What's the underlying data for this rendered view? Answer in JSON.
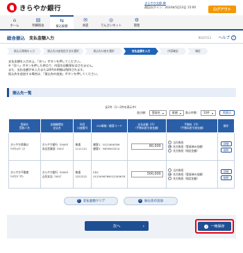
{
  "header": {
    "bank_name": "きらやか銀行",
    "user_name": "きらやか太郎 様",
    "last_login": "前回ログイン：2024年5月13日 15:00",
    "logout_label": "ログアウト"
  },
  "nav": {
    "items": [
      {
        "icon": "⌂",
        "label": "ホーム"
      },
      {
        "icon": "▤",
        "label": "明細照会"
      },
      {
        "icon": "⇆",
        "label": "振込振替"
      },
      {
        "icon": "✉",
        "label": "承認"
      },
      {
        "icon": "◎",
        "label": "でんさいネット"
      },
      {
        "icon": "⚙",
        "label": "管理"
      }
    ]
  },
  "title": {
    "main": "総合振込",
    "sub": "支払金額入力",
    "code": "BSGF013",
    "help_label": "ヘルプ",
    "help_icon": "?"
  },
  "steps": [
    "振込元情報を入力",
    "振込先口座指定方法を選択",
    "振込先口座を選択",
    "支払金額を入力",
    "内容確認",
    "確定"
  ],
  "intro": [
    "支払金額を入力の上、「次へ」ボタンを押してください。",
    "※「次へ」ボタンを押した時点で、内容の自動保存はされません。",
    "また、支払金額が未入力または0円の明細は削除されます。",
    "振込先を追加する場合は、「振込先の追加」ボタンを押してください。"
  ],
  "section": {
    "title": "振込先一覧",
    "count": "全2件（1〜2件を表示中）",
    "sort_label": "並び順：",
    "sort_value": "登録名",
    "order_value": "昇順",
    "per_page_label": "表示件数：",
    "per_page_value": "10件",
    "redisplay_label": "再表示"
  },
  "table": {
    "headers": [
      "登録名\n受取人名",
      "金融機関名\n支店名",
      "科目\n口座番号",
      "EDI情報／顧客コード",
      "支払金額（円）\n（手数料差引前金額）",
      "手数料（円）\n（手数料差引前金額）",
      "操作"
    ],
    "rows": [
      {
        "reg_name": "きらやか商事(ｶ",
        "payee": "ｷﾗﾔｶｼｮｳｼﾞ(ｶ",
        "bank": "きらやか銀行（0000）",
        "branch": "本店営業部（001）",
        "account_type": "普通",
        "account_no": "1111111",
        "edi": "顧客1：0123456789",
        "customer": "顧客2：9876543210",
        "amount": "80,000",
        "fee_options": [
          "当方負担",
          "先方負担（登録済み金額）",
          "先方負担（指定金額）"
        ],
        "fee_selected": 1,
        "fee_value": "",
        "op_detail": "詳細",
        "op_clear": "削除"
      },
      {
        "reg_name": "きらやか不動産",
        "payee": "ｷﾗﾔｶﾌﾄﾞｳｻﾝ",
        "bank": "きらやか銀行（0000）",
        "branch": "山形支店（002）",
        "account_type": "普通",
        "account_no": "2222222",
        "edi": "EDI：",
        "customer": "0123456789012345678",
        "amount": "500,000",
        "fee_options": [
          "当方負担",
          "先方負担（登録済み金額）",
          "先方負担（指定金額）"
        ],
        "fee_selected": 1,
        "fee_value": "",
        "op_detail": "詳細",
        "op_clear": "削除"
      }
    ]
  },
  "buttons": {
    "clear_all": "支払金額クリア",
    "add_payee": "振込先の追加",
    "next": "次へ",
    "temp_save": "一時保存"
  }
}
